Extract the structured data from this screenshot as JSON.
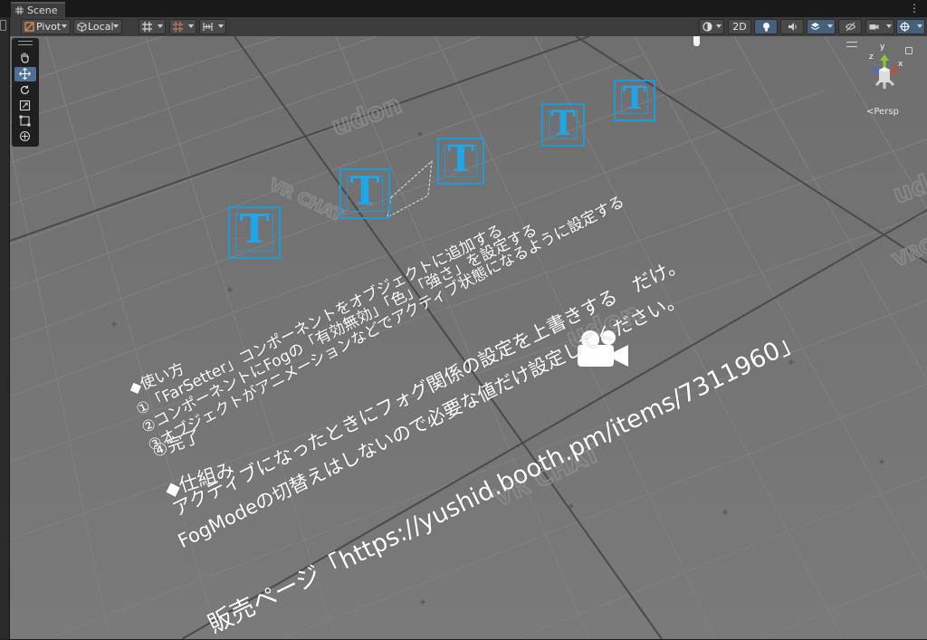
{
  "window": {
    "tab_label": "Scene",
    "menu_glyph": "⋮"
  },
  "toolbar": {
    "pivot_label": "Pivot",
    "local_label": "Local",
    "view_2d_label": "2D",
    "icons": [
      "grid-snap-icon",
      "increment-snap-icon",
      "shading-mode-icon",
      "lighting-icon",
      "audio-icon",
      "effects-icon",
      "visibility-icon",
      "camera-icon",
      "gizmos-icon"
    ]
  },
  "tools": [
    "hand-tool",
    "move-tool",
    "rotate-tool",
    "scale-tool",
    "rect-tool",
    "transform-tool"
  ],
  "gizmo": {
    "y_label": "y",
    "x_label": "x",
    "z_label": "z",
    "projection_label": "<Persp"
  },
  "scene_text": {
    "usage_heading": "◆使い方",
    "step1": "①「FarSetter」コンポーネントをオブジェクトに追加する",
    "step2": "②コンポーネントにFogの「有効無効」「色」「強さ」を設定する",
    "step3": "③オブジェクトがアニメーションなどでアクティブ状態になるように設定する",
    "step4": "④完了",
    "mechanism_heading": "◆仕組み",
    "mechanism_line1": "アクティブになったときにフォグ関係の設定を上書きする　だけ。",
    "mechanism_line2": "FogModeの切替えはしないので必要な値だけ設定してください。",
    "sales_page": "販売ページ「https://yushid.booth.pm/items/7311960」"
  },
  "colors": {
    "scene_bg": "#757575",
    "text_icon": "#1fa6e8",
    "selection": "#4f6f96"
  }
}
